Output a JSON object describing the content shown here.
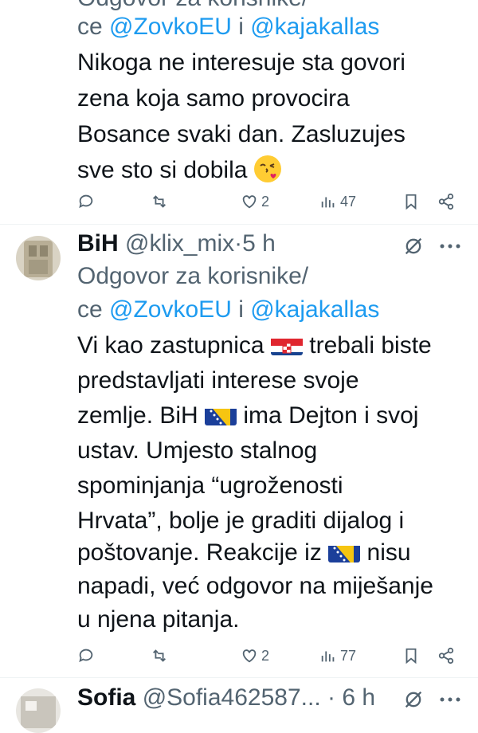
{
  "tweet1": {
    "reply_header_partial": "Odgovor za korisnike/",
    "reply_to_prefix": "ce",
    "mention1": "@ZovkoEU",
    "connector": "i",
    "mention2": "@kajakallas",
    "text_lines": [
      "Nikoga ne interesuje sta govori",
      "zena koja samo provocira",
      "Bosance svaki dan. Zasluzujes",
      "sve sto si dobila"
    ],
    "emoji": "face-blowing-kiss",
    "likes": "2",
    "views": "47"
  },
  "tweet2": {
    "display_name": "BiH",
    "handle": "@klix_mix",
    "dot": "·",
    "time": "5 h",
    "reply_header": "Odgovor za korisnike/",
    "reply_to_prefix": "ce",
    "mention1": "@ZovkoEU",
    "connector": "i",
    "mention2": "@kajakallas",
    "line1_a": "Vi kao zastupnica",
    "line1_b": "trebali biste",
    "line2": "predstavljati interese svoje",
    "line3_a": "zemlje. BiH",
    "line3_b": "ima Dejton i svoj",
    "line4": "ustav. Umjesto stalnog",
    "line5": "spominjanja “ugroženosti",
    "line6": "Hrvata”, bolje je graditi dijalog i",
    "line7_a": "poštovanje. Reakcije iz",
    "line7_b": "nisu",
    "line8": "napadi, već odgovor na miješanje",
    "line9": "u njena pitanja.",
    "likes": "2",
    "views": "77"
  },
  "tweet3": {
    "display_name": "Sofia",
    "handle": "@Sofia462587...",
    "dot": "·",
    "time": "6 h"
  },
  "colors": {
    "text": "#0f1419",
    "muted": "#536471",
    "link": "#1d9bf0",
    "divider": "#eff3f4"
  }
}
